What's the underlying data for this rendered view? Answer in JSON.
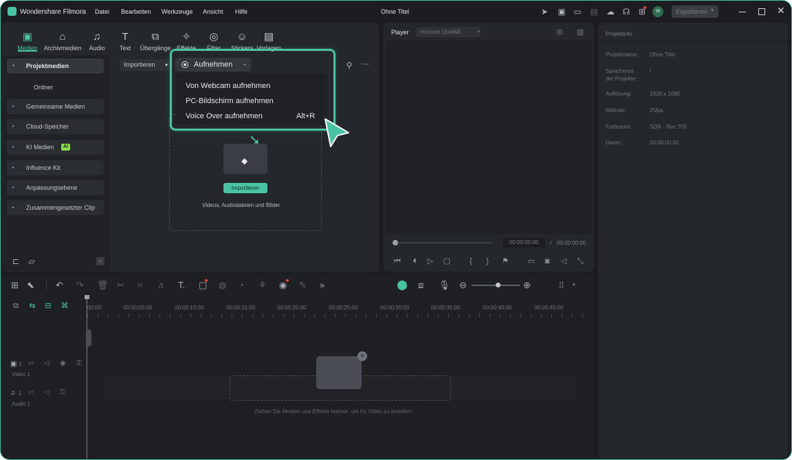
{
  "app": {
    "name": "Wondershare Filmora",
    "document_title": "Ohne Titel"
  },
  "menubar": [
    "Datei",
    "Bearbeiten",
    "Werkzeuge",
    "Ansicht",
    "Hilfe"
  ],
  "window_controls": {
    "user_initial": "W",
    "export_label": "Exportieren"
  },
  "media_tabs": [
    {
      "label": "Medien",
      "icon": "media-icon"
    },
    {
      "label": "Archivmedien",
      "icon": "archive-icon"
    },
    {
      "label": "Audio",
      "icon": "music-icon"
    },
    {
      "label": "Text",
      "icon": "text-icon"
    },
    {
      "label": "Übergänge",
      "icon": "transition-icon"
    },
    {
      "label": "Effekte",
      "icon": "effects-icon"
    },
    {
      "label": "Filter",
      "icon": "filter-icon"
    },
    {
      "label": "Stickers",
      "icon": "sticker-icon"
    },
    {
      "label": "Vorlagen",
      "icon": "template-icon"
    }
  ],
  "sidebar": {
    "project_media": "Projektmedien",
    "folder": "Ordner",
    "items": [
      "Gemeinsame Medien",
      "Cloud-Speicher",
      "KI Medien",
      "Influence Kit",
      "Anpassungsebene",
      "Zusammengesetzter Clip"
    ],
    "ai_badge": "AI"
  },
  "toolbar": {
    "import_label": "Importieren",
    "record_label": "Aufnehmen"
  },
  "record_menu": [
    {
      "label": "Von Webcam aufnehmen",
      "shortcut": ""
    },
    {
      "label": "PC-Bildschirm aufnehmen",
      "shortcut": ""
    },
    {
      "label": "Voice Over aufnehmen",
      "shortcut": "Alt+R"
    }
  ],
  "dropzone": {
    "button": "Importieren",
    "hint": "Videos, Audiodateien und Bilder"
  },
  "player": {
    "label": "Player",
    "quality": "Höchste Qualität",
    "current": "00:00:00:00",
    "separator": "/",
    "total": "00:00:00:00"
  },
  "project_info": {
    "title": "Projektinfo:",
    "rows": [
      {
        "k": "Projektname:",
        "v": "Ohne Titel"
      },
      {
        "k": "Speicherort der Projekte:",
        "v": "/"
      },
      {
        "k": "Auflösung:",
        "v": "1920 x 1080"
      },
      {
        "k": "Bildrate:",
        "v": "25fps"
      },
      {
        "k": "Farbraum:",
        "v": "SDR - Rec.709"
      },
      {
        "k": "Dauer:",
        "v": "00:00:00:00"
      }
    ]
  },
  "timeline": {
    "ticks": [
      "00:00",
      "00:00:05:00",
      "00:00:10:00",
      "00:00:15:00",
      "00:00:20:00",
      "00:00:25:00",
      "00:00:30:00",
      "00:00:35:00",
      "00:00:40:00",
      "00:00:45:00"
    ],
    "tracks": [
      {
        "label": "Video 1",
        "num": "1"
      },
      {
        "label": "Audio 1",
        "num": "1"
      }
    ],
    "drop_hint": "Ziehen Sie Medien und Effekte hierher, um Ihr Video zu erstellen."
  },
  "colors": {
    "accent": "#49c3a1",
    "bg": "#1b1d20",
    "panel": "#24272b"
  }
}
